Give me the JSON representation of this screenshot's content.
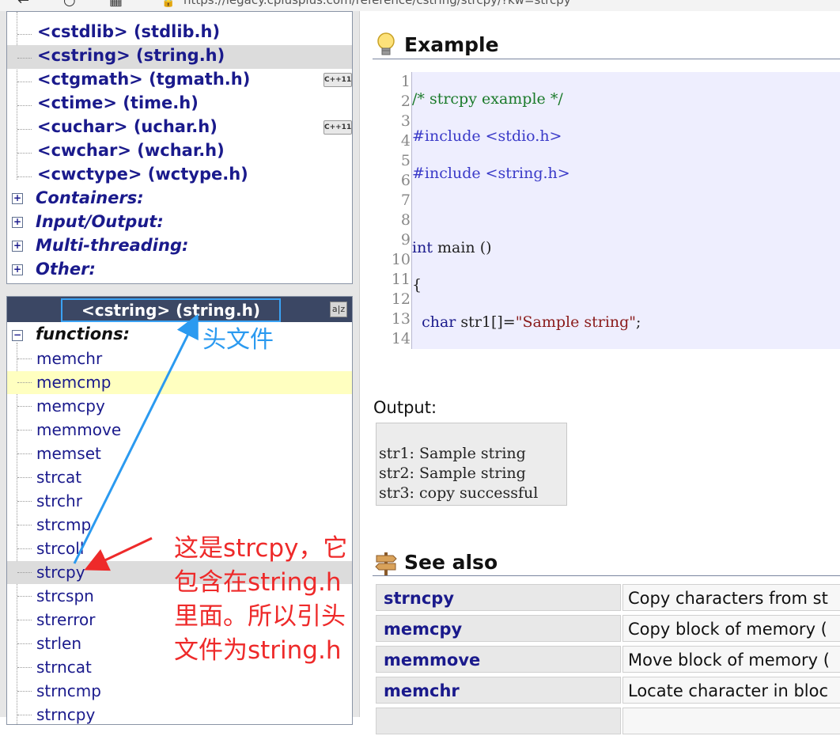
{
  "browser": {
    "url": "https://legacy.cplusplus.com/reference/cstring/strcpy/?kw=strcpy"
  },
  "sidebar": {
    "headers": [
      {
        "label": "<cstdlib> (stdlib.h)",
        "cpp11": false
      },
      {
        "label": "<cstring> (string.h)",
        "cpp11": false,
        "selected": true
      },
      {
        "label": "<ctgmath> (tgmath.h)",
        "cpp11": true
      },
      {
        "label": "<ctime> (time.h)",
        "cpp11": false
      },
      {
        "label": "<cuchar> (uchar.h)",
        "cpp11": true
      },
      {
        "label": "<cwchar> (wchar.h)",
        "cpp11": false
      },
      {
        "label": "<cwctype> (wctype.h)",
        "cpp11": false
      }
    ],
    "cpp11_badge": "C++11",
    "categories": [
      "Containers:",
      "Input/Output:",
      "Multi-threading:",
      "Other:"
    ],
    "expand_symbol": "+",
    "collapse_symbol": "−"
  },
  "functions_panel": {
    "title": "<cstring> (string.h)",
    "sort_badge": "a|z",
    "group_label": "functions:",
    "items": [
      "memchr",
      "memcmp",
      "memcpy",
      "memmove",
      "memset",
      "strcat",
      "strchr",
      "strcmp",
      "strcoll",
      "strcpy",
      "strcspn",
      "strerror",
      "strlen",
      "strncat",
      "strncmp",
      "strncpy"
    ],
    "highlighted": "memcmp",
    "selected": "strcpy"
  },
  "example": {
    "title": "Example",
    "line_numbers": [
      "1",
      "2",
      "3",
      "4",
      "5",
      "6",
      "7",
      "8",
      "9",
      "10",
      "11",
      "12",
      "13",
      "14"
    ]
  },
  "output": {
    "label": "Output:",
    "lines": [
      "str1: Sample string",
      "str2: Sample string",
      "str3: copy successful"
    ]
  },
  "see_also": {
    "title": "See also",
    "rows": [
      {
        "name": "strncpy",
        "desc": "Copy characters from st"
      },
      {
        "name": "memcpy",
        "desc": "Copy block of memory ("
      },
      {
        "name": "memmove",
        "desc": "Move block of memory ("
      },
      {
        "name": "memchr",
        "desc": "Locate character in bloc"
      },
      {
        "name": "",
        "desc": ""
      }
    ]
  },
  "annotations": {
    "header_note": "头文件",
    "strcpy_note": "这是strcpy，它包含在string.h里面。所以引头文件为string.h",
    "colors": {
      "blue": "#2b9af0",
      "red": "#ee2a2a"
    }
  }
}
